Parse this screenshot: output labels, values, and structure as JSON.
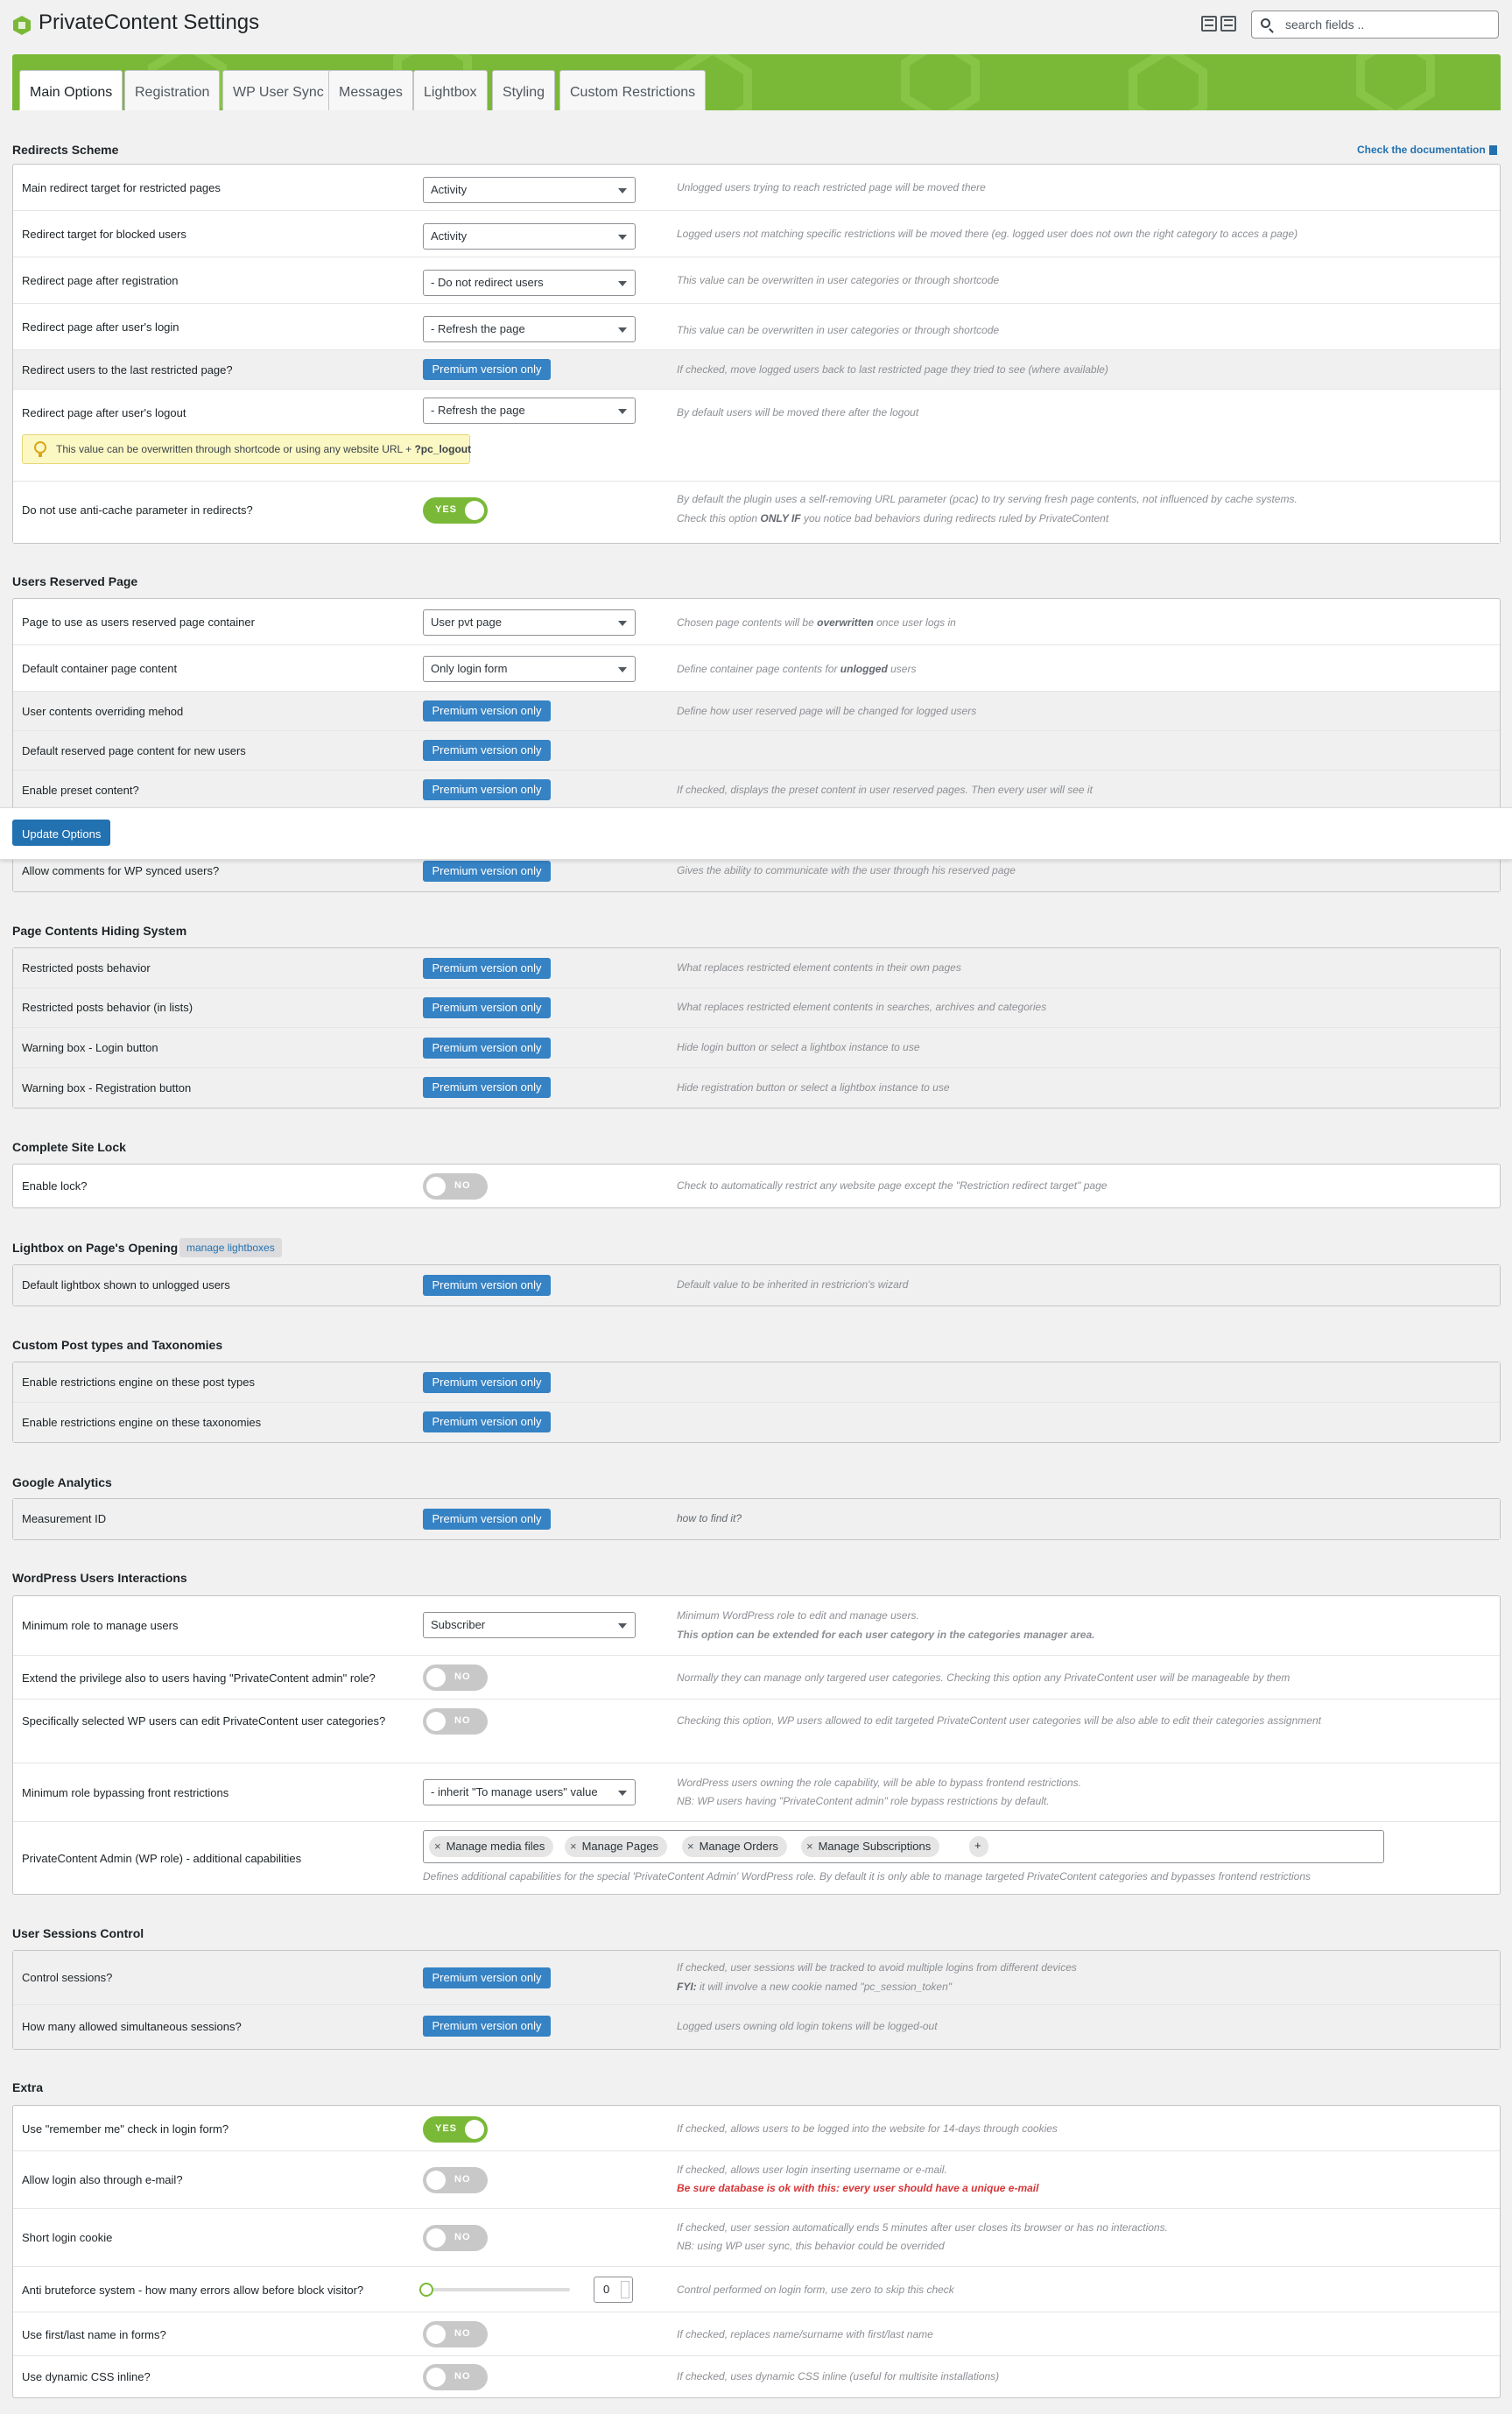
{
  "header": {
    "title": "PrivateContent Settings",
    "search_placeholder": "search fields .."
  },
  "tabs": [
    "Main Options",
    "Registration",
    "WP User Sync",
    "Messages",
    "Lightbox",
    "Styling",
    "Custom Restrictions"
  ],
  "doc_link": "Check the documentation",
  "update_button": "Update Options",
  "sections": {
    "redirects": {
      "title": "Redirects Scheme",
      "rows": [
        {
          "label": "Main redirect target for restricted pages",
          "value": "Activity",
          "desc": "Unlogged users trying to reach restricted page will be moved there"
        },
        {
          "label": "Redirect target for blocked users",
          "value": "Activity",
          "desc": "Logged users not matching specific restrictions will be moved there (eg. logged user does not own the right category to acces a page)"
        },
        {
          "label": "Redirect page after registration",
          "value": "- Do not redirect users",
          "desc": "This value can be overwritten in user categories or through shortcode"
        },
        {
          "label": "Redirect page after user's login",
          "value": "- Refresh the page",
          "desc": "This value can be overwritten in user categories or through shortcode"
        },
        {
          "label": "Redirect users to the last restricted page?",
          "value": "Premium version only",
          "desc": "If checked, move logged users back to last restricted page they tried to see (where available)"
        },
        {
          "label": "Redirect page after user's logout",
          "value": "- Refresh the page",
          "desc": "By default users will be moved there after the logout",
          "note_text": "This value can be overwritten through shortcode or using any website URL + ",
          "note_code": "?pc_logout"
        },
        {
          "label": "Do not use anti-cache parameter in redirects?",
          "value": "YES",
          "desc1": "By default the plugin uses a self-removing URL parameter (pcac) to try serving fresh page contents, not influenced by cache systems.",
          "desc2_a": "Check this option ",
          "desc2_b": "ONLY IF",
          "desc2_c": " you notice bad behaviors during redirects ruled by PrivateContent"
        }
      ]
    },
    "reserved": {
      "title": "Users Reserved Page",
      "rows": [
        {
          "label": "Page to use as users reserved page container",
          "value": "User pvt page",
          "desc_a": "Chosen page contents will be ",
          "desc_b": "overwritten",
          "desc_c": " once user logs in"
        },
        {
          "label": "Default container page content",
          "value": "Only login form",
          "desc_a": "Define container page contents for ",
          "desc_b": "unlogged",
          "desc_c": " users"
        },
        {
          "label": "User contents overriding mehod",
          "value": "Premium version only",
          "desc": "Define how user reserved page will be changed for logged users"
        },
        {
          "label": "Default reserved page content for new users",
          "value": "Premium version only",
          "desc": ""
        },
        {
          "label": "Enable preset content?",
          "value": "Premium version only",
          "desc": "If checked, displays the preset content in user reserved pages. Then every user will see it"
        },
        {
          "label": "Allow comments for WP synced users?",
          "value": "Premium version only",
          "desc": "Gives the ability to communicate with the user through his reserved page"
        }
      ]
    },
    "hiding": {
      "title": "Page Contents Hiding System",
      "rows": [
        {
          "label": "Restricted posts behavior",
          "value": "Premium version only",
          "desc": "What replaces restricted element contents in their own pages"
        },
        {
          "label": "Restricted posts behavior (in lists)",
          "value": "Premium version only",
          "desc": "What replaces restricted element contents in searches, archives and categories"
        },
        {
          "label": "Warning box - Login button",
          "value": "Premium version only",
          "desc": "Hide login button or select a lightbox instance to use"
        },
        {
          "label": "Warning box - Registration button",
          "value": "Premium version only",
          "desc": "Hide registration button or select a lightbox instance to use"
        }
      ]
    },
    "sitelock": {
      "title": "Complete Site Lock",
      "rows": [
        {
          "label": "Enable lock?",
          "value": "NO",
          "desc": "Check to automatically restrict any website page except the \"Restriction redirect target\" page"
        }
      ]
    },
    "lightbox": {
      "title": "Lightbox on Page's Opening",
      "tag": "manage lightboxes",
      "rows": [
        {
          "label": "Default lightbox shown to unlogged users",
          "value": "Premium version only",
          "desc": "Default value to be inherited in restricrion's wizard"
        }
      ]
    },
    "cpt": {
      "title": "Custom Post types and Taxonomies",
      "rows": [
        {
          "label": "Enable restrictions engine on these post types",
          "value": "Premium version only"
        },
        {
          "label": "Enable restrictions engine on these taxonomies",
          "value": "Premium version only"
        }
      ]
    },
    "ga": {
      "title": "Google Analytics",
      "rows": [
        {
          "label": "Measurement ID",
          "value": "Premium version only",
          "desc": "how to find it?"
        }
      ]
    },
    "wpusers": {
      "title": "WordPress Users Interactions",
      "rows": [
        {
          "label": "Minimum role to manage users",
          "value": "Subscriber",
          "desc1": "Minimum WordPress role to edit and manage users.",
          "desc2": "This option can be extended for each user category in the categories manager area."
        },
        {
          "label": "Extend the privilege also to users having \"PrivateContent admin\" role?",
          "value": "NO",
          "desc": "Normally they can manage only targered user categories. Checking this option any PrivateContent user will be manageable by them"
        },
        {
          "label": "Specifically selected WP users can edit PrivateContent user categories?",
          "value": "NO",
          "desc": "Checking this option, WP users allowed to edit targeted PrivateContent user categories will be also able to edit their categories assignment"
        },
        {
          "label": "Minimum role bypassing front restrictions",
          "value": "- inherit \"To manage users\" value",
          "desc1": "WordPress users owning the role capability, will be able to bypass frontend restrictions.",
          "desc2": "NB: WP users having \"PrivateContent admin\" role bypass restrictions by default."
        },
        {
          "label": "PrivateContent Admin (WP role) - additional capabilities",
          "chips": [
            "Manage media files",
            "Manage Pages",
            "Manage Orders",
            "Manage Subscriptions"
          ],
          "chip_add": "+",
          "desc": "Defines additional capabilities for the special 'PrivateContent Admin' WordPress role. By default it is only able to manage targeted PrivateContent categories and bypasses frontend restrictions"
        }
      ]
    },
    "sessions": {
      "title": "User Sessions Control",
      "rows": [
        {
          "label": "Control sessions?",
          "value": "Premium version only",
          "desc1": "If checked, user sessions will be tracked to avoid multiple logins from different devices",
          "desc2_a": "FYI:",
          "desc2_b": " it will involve a new cookie named \"pc_session_token\""
        },
        {
          "label": "How many allowed simultaneous sessions?",
          "value": "Premium version only",
          "desc": "Logged users owning old login tokens will be logged-out"
        }
      ]
    },
    "extra": {
      "title": "Extra",
      "rows": [
        {
          "label": "Use \"remember me\" check in login form?",
          "value": "YES",
          "desc": "If checked, allows users to be logged into the website for 14-days through cookies"
        },
        {
          "label": "Allow login also through e-mail?",
          "value": "NO",
          "desc1": "If checked, allows user login inserting username or e-mail.",
          "desc2": "Be sure database is ok with this: every user should have a unique e-mail"
        },
        {
          "label": "Short login cookie",
          "value": "NO",
          "desc1": "If checked, user session automatically ends 5 minutes after user closes its browser or has no interactions.",
          "desc2": "NB: using WP user sync, this behavior could be overrided"
        },
        {
          "label": "Anti bruteforce system - how many errors allow before block visitor?",
          "value": "0",
          "desc": "Control performed on login form, use zero to skip this check"
        },
        {
          "label": "Use first/last name in forms?",
          "value": "NO",
          "desc": "If checked, replaces name/surname with first/last name"
        },
        {
          "label": "Use dynamic CSS inline?",
          "value": "NO",
          "desc": "If checked, uses dynamic CSS inline (useful for multisite installations)"
        }
      ]
    }
  },
  "colors": {
    "accent": "#7ab937",
    "button": "#3582c4",
    "primary": "#2271b1"
  }
}
